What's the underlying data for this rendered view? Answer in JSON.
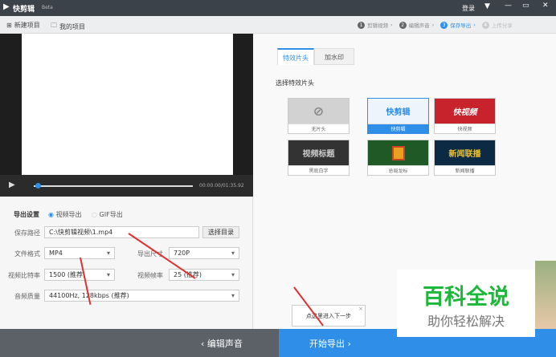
{
  "app": {
    "name": "快剪辑",
    "badge": "Beta",
    "login": "登录"
  },
  "toolbar": {
    "new_project": "新建项目",
    "my_projects": "我的项目"
  },
  "steps": [
    {
      "num": "1",
      "label": "剪辑视频"
    },
    {
      "num": "2",
      "label": "编辑声音"
    },
    {
      "num": "3",
      "label": "保存导出",
      "active": true
    },
    {
      "num": "4",
      "label": "上传分享"
    }
  ],
  "player": {
    "time": "00:00.00/01:35.92",
    "progress": 0.02
  },
  "export": {
    "title": "导出设置",
    "mode_video": "视频导出",
    "mode_gif": "GIF导出",
    "selected_mode": "视频导出",
    "path_label": "保存路径",
    "path_value": "C:\\快剪辑视频\\1.mp4",
    "choose_dir": "选择目录",
    "format_label": "文件格式",
    "format_value": "MP4",
    "size_label": "导出尺寸",
    "size_value": "720P",
    "bitrate_label": "视频比特率",
    "bitrate_value": "1500 (推荐)",
    "fps_label": "视频帧率",
    "fps_value": "25 (推荐)",
    "audio_label": "音频质量",
    "audio_value": "44100Hz, 128kbps (推荐)"
  },
  "right": {
    "tabs": [
      "特效片头",
      "加水印"
    ],
    "active_tab": "特效片头",
    "section_title": "选择特效片头",
    "intros": [
      {
        "caption": "无片头",
        "thumb": "⊘"
      },
      {
        "caption": "快剪辑",
        "thumb": "快剪辑",
        "selected": true
      },
      {
        "caption": "快视频",
        "thumb": "快视频"
      },
      {
        "caption": "黑底白字",
        "thumb": "视频标题"
      },
      {
        "caption": "总局龙标",
        "thumb": ""
      },
      {
        "caption": "新闻联播",
        "thumb": "新闻联播"
      }
    ]
  },
  "tooltip": "点这里进入下一步",
  "bottom": {
    "back": "编辑声音",
    "next": "开始导出"
  },
  "watermark": {
    "title": "百科全说",
    "subtitle": "助你轻松解决"
  },
  "colors": {
    "accent": "#2f8fe8",
    "titlebar": "#3c4249",
    "watermark_green": "#1db83a"
  }
}
